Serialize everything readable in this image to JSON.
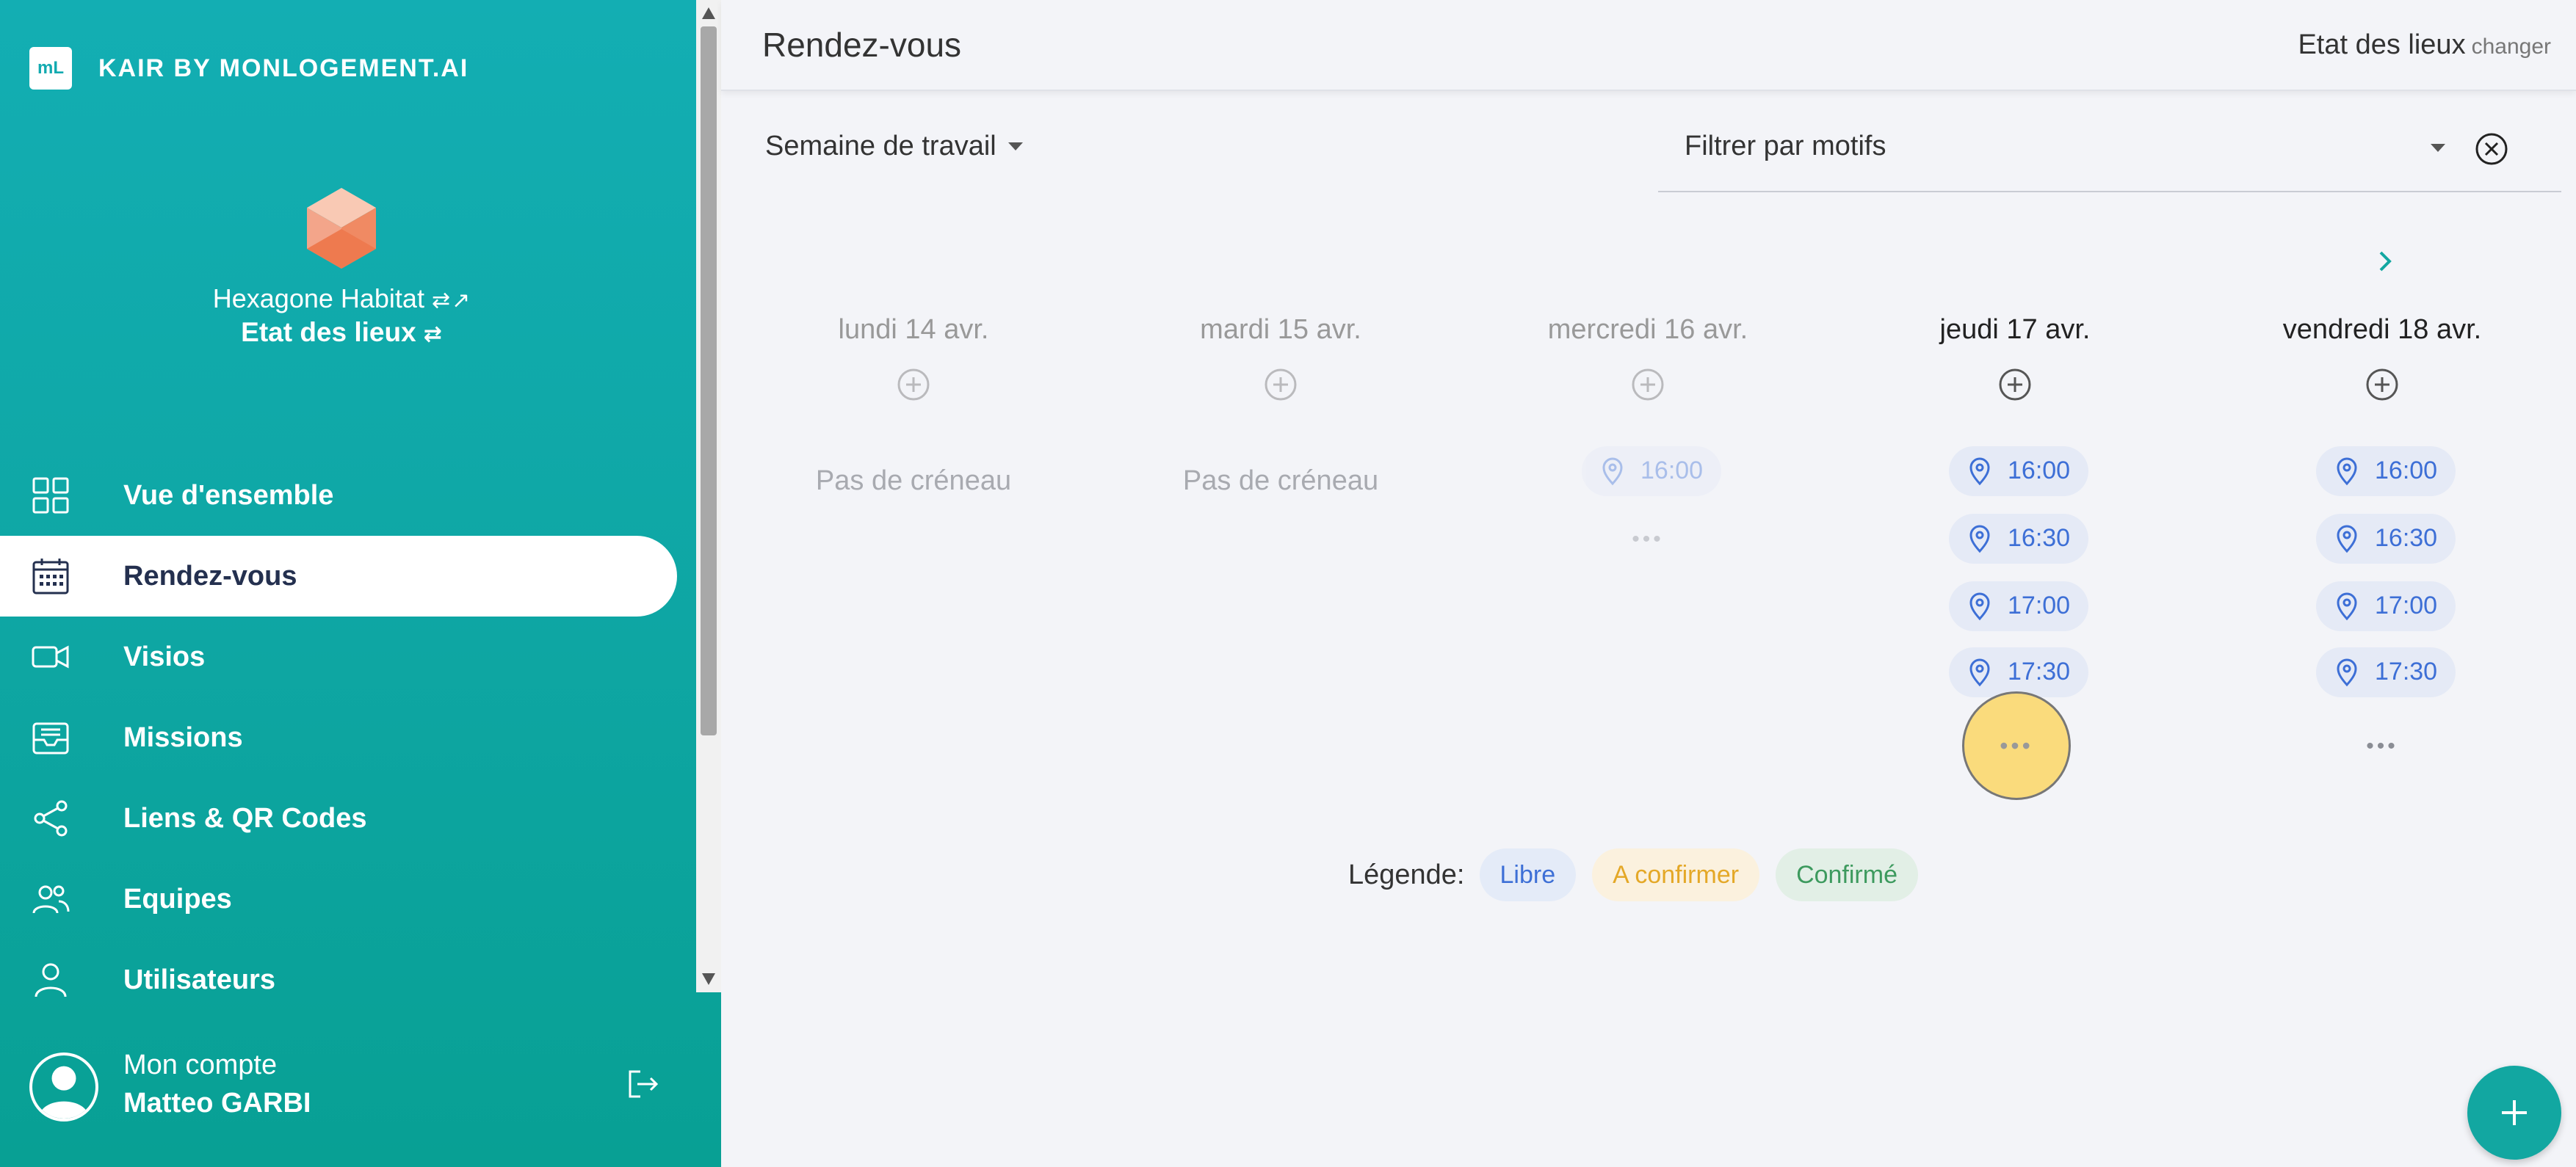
{
  "brand": {
    "logo": "mL",
    "name": "KAIR BY MONLOGEMENT.AI"
  },
  "organization": {
    "name": "Hexagone Habitat",
    "subtitle": "Etat des lieux"
  },
  "nav": [
    {
      "label": "Vue d'ensemble",
      "icon": "grid-icon",
      "active": false
    },
    {
      "label": "Rendez-vous",
      "icon": "calendar-icon",
      "active": true
    },
    {
      "label": "Visios",
      "icon": "video-icon",
      "active": false
    },
    {
      "label": "Missions",
      "icon": "inbox-icon",
      "active": false
    },
    {
      "label": "Liens & QR Codes",
      "icon": "share-icon",
      "active": false
    },
    {
      "label": "Equipes",
      "icon": "team-icon",
      "active": false
    },
    {
      "label": "Utilisateurs",
      "icon": "user-icon",
      "active": false
    }
  ],
  "account": {
    "label": "Mon compte",
    "name": "Matteo GARBI"
  },
  "header": {
    "title": "Rendez-vous",
    "context": "Etat des lieux",
    "change": "changer"
  },
  "toolbar": {
    "week": "Semaine de travail",
    "filter": "Filtrer par motifs"
  },
  "days": [
    {
      "label": "lundi 14 avr.",
      "empty": "Pas de créneau",
      "slots": []
    },
    {
      "label": "mardi 15 avr.",
      "empty": "Pas de créneau",
      "slots": []
    },
    {
      "label": "mercredi 16 avr.",
      "slots": [
        "16:00"
      ]
    },
    {
      "label": "jeudi 17 avr.",
      "slots": [
        "16:00",
        "16:30",
        "17:00",
        "17:30"
      ]
    },
    {
      "label": "vendredi 18 avr.",
      "slots": [
        "16:00",
        "16:30",
        "17:00",
        "17:30"
      ]
    }
  ],
  "legend": {
    "title": "Légende:",
    "libre": "Libre",
    "a_confirmer": "A confirmer",
    "confirme": "Confirmé"
  },
  "colors": {
    "sidebar": "#0ea6a3",
    "accent": "#3d6fd6",
    "highlight": "#fad666"
  }
}
